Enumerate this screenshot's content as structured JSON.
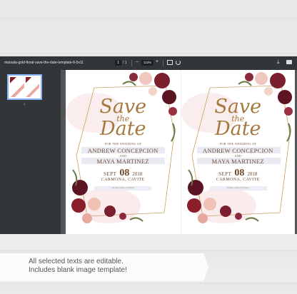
{
  "viewer": {
    "file_title": "marsala-gold-floral-save-the-date-template-8-5x11",
    "current_page": "1",
    "page_separator": "/",
    "total_pages": "1",
    "zoom_minus": "−",
    "zoom_level": "113%",
    "zoom_plus": "+",
    "download_icon": "download-icon",
    "print_icon": "print-icon",
    "thumbnail_number": "1"
  },
  "invite": {
    "save": "Save",
    "the": "the",
    "date": "Date",
    "for_wedding": "FOR THE WEDDING OF",
    "name1": "ANDREW CONCEPCION",
    "and": "- AND -",
    "name2": "MAYA MARTINEZ",
    "month": "SEPT",
    "day": "08",
    "year": "2018",
    "place": "CARMONA, CAVITE",
    "note": "formal invite to follow",
    "colors": {
      "burgundy": "#7b1e2e",
      "gold": "#a5793e",
      "blush": "#e8b0a6"
    }
  },
  "banner": {
    "line1": "All selected texts are editable.",
    "line2": "Includes blank image template!"
  }
}
